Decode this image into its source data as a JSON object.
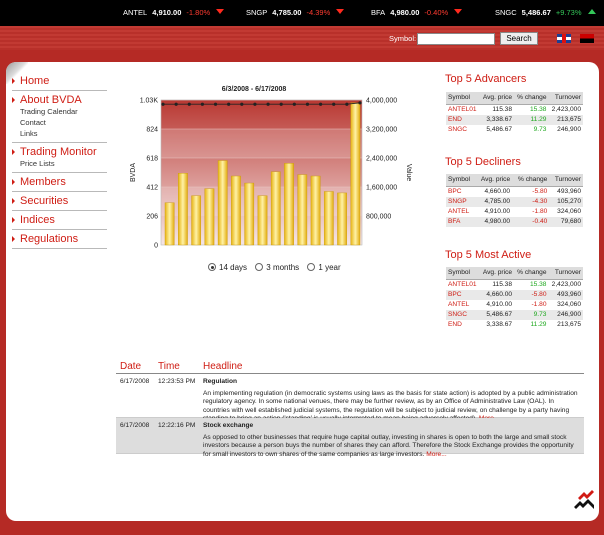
{
  "ticker": [
    {
      "symbol": "ANTEL",
      "price": "4,910.00",
      "change": "-1.80%",
      "direction": "down"
    },
    {
      "symbol": "SNGP",
      "price": "4,785.00",
      "change": "-4.39%",
      "direction": "down"
    },
    {
      "symbol": "BFA",
      "price": "4,980.00",
      "change": "-0.40%",
      "direction": "down"
    },
    {
      "symbol": "SNGC",
      "price": "5,486.67",
      "change": "+9.73%",
      "direction": "up"
    }
  ],
  "header": {
    "symbol_label": "Symbol:",
    "symbol_value": "",
    "search_label": "Search",
    "flag_left": "uk-flag-icon",
    "flag_right": "angola-flag-icon"
  },
  "nav": [
    {
      "label": "Home",
      "subs": []
    },
    {
      "label": "About BVDA",
      "subs": [
        "Trading Calendar",
        "Contact",
        "Links"
      ]
    },
    {
      "label": "Trading Monitor",
      "subs": [
        "Price Lists"
      ]
    },
    {
      "label": "Members",
      "subs": []
    },
    {
      "label": "Securities",
      "subs": []
    },
    {
      "label": "Indices",
      "subs": []
    },
    {
      "label": "Regulations",
      "subs": []
    }
  ],
  "chart_data": {
    "type": "bar",
    "title": "6/3/2008 - 6/17/2008",
    "ylabel": "BVDA",
    "y2label": "Value",
    "ylim": [
      0,
      1030
    ],
    "y2lim": [
      0,
      4000000
    ],
    "yticks": [
      "1.03K",
      "824",
      "618",
      "412",
      "206",
      "0"
    ],
    "y2ticks": [
      "4,000,000",
      "3,200,000",
      "2,400,000",
      "1,600,000",
      "800,000",
      ""
    ],
    "bars": [
      300,
      510,
      350,
      400,
      600,
      490,
      440,
      350,
      520,
      580,
      500,
      490,
      380,
      370,
      1010
    ],
    "line": [
      1000,
      1000,
      1000,
      1000,
      1000,
      1000,
      1000,
      1000,
      1000,
      1000,
      1000,
      1000,
      1000,
      1000,
      1000,
      1010
    ],
    "colors": {
      "bar": "#f2cc24",
      "line": "#222222",
      "band_top": "#b93832",
      "band_bottom": "#f5e6e5"
    }
  },
  "ranges": {
    "options": [
      "14 days",
      "3 months",
      "1 year"
    ],
    "selected": "14 days"
  },
  "tables": [
    {
      "title": "Top 5 Advancers",
      "headers": [
        "Symbol",
        "Avg. price",
        "% change",
        "Turnover"
      ],
      "rows": [
        [
          "ANTEL01",
          "115.38",
          "15.38",
          "2,423,000"
        ],
        [
          "END",
          "3,338.67",
          "11.29",
          "213,675"
        ],
        [
          "SNGC",
          "5,486.67",
          "9.73",
          "246,900"
        ]
      ],
      "sign": "pos"
    },
    {
      "title": "Top 5 Decliners",
      "headers": [
        "Symbol",
        "Avg. price",
        "% change",
        "Turnover"
      ],
      "rows": [
        [
          "BPC",
          "4,660.00",
          "-5.80",
          "493,960"
        ],
        [
          "SNGP",
          "4,785.00",
          "-4.30",
          "105,270"
        ],
        [
          "ANTEL",
          "4,910.00",
          "-1.80",
          "324,060"
        ],
        [
          "BFA",
          "4,980.00",
          "-0.40",
          "79,680"
        ]
      ],
      "sign": "neg"
    },
    {
      "title": "Top 5 Most Active",
      "headers": [
        "Symbol",
        "Avg. price",
        "% change",
        "Turnover"
      ],
      "rows": [
        [
          "ANTEL01",
          "115.38",
          "15.38",
          "2,423,000"
        ],
        [
          "BPC",
          "4,660.00",
          "-5.80",
          "493,960"
        ],
        [
          "ANTEL",
          "4,910.00",
          "-1.80",
          "324,060"
        ],
        [
          "SNGC",
          "5,486.67",
          "9.73",
          "246,900"
        ],
        [
          "END",
          "3,338.67",
          "11.29",
          "213,675"
        ]
      ],
      "sign": "mixed"
    }
  ],
  "news": {
    "headers": {
      "date": "Date",
      "time": "Time",
      "headline": "Headline"
    },
    "items": [
      {
        "date": "6/17/2008",
        "time": "12:23:53 PM",
        "title": "Regulation",
        "body": "An implementing regulation (in democratic systems using laws as the basis for state action) is adopted by a public administration regulatory agency. In some national venues, there may be further review, as by an Office of Administrative Law (OAL). In countries with well established judicial systems, the regulation will be subject to judicial review, on challenge by a party having standing to bring an action ('standing' is usually interpreted to mean being adversely affected).",
        "more": "More..."
      },
      {
        "date": "6/17/2008",
        "time": "12:22:16 PM",
        "title": "Stock exchange",
        "body": "As opposed to other businesses that require huge capital outlay, investing in shares is open to both the large and small stock investors because a person buys the number of shares they can afford. Therefore the Stock Exchange provides the opportunity for small investors to own shares of the same companies as large investors.",
        "more": "More..."
      }
    ]
  }
}
